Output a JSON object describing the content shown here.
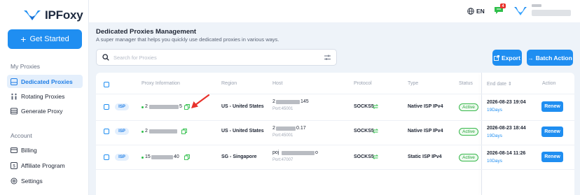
{
  "brand": {
    "name": "IPFoxy"
  },
  "sidebar": {
    "get_started": "Get Started",
    "section_proxies": "My Proxies",
    "nav_proxies": [
      {
        "label": "Dedicated Proxies",
        "icon": "list-icon",
        "active": true
      },
      {
        "label": "Rotating Proxies",
        "icon": "rotating-icon",
        "active": false
      },
      {
        "label": "Generate Proxy",
        "icon": "generate-icon",
        "active": false
      }
    ],
    "section_account": "Account",
    "nav_account": [
      {
        "label": "Billing",
        "icon": "billing-icon"
      },
      {
        "label": "Affiliate Program",
        "icon": "affiliate-icon"
      },
      {
        "label": "Settings",
        "icon": "settings-icon"
      }
    ]
  },
  "topbar": {
    "language": "EN",
    "message_count": "4"
  },
  "main": {
    "title": "Dedicated Proxies Management",
    "subtitle": "A super manager that helps you quickly use dedicated proxies in various ways.",
    "search_placeholder": "Search for Proxies",
    "export_label": "Export",
    "batch_label": "Batch Action"
  },
  "table": {
    "headers": {
      "proxy_info": "Proxy Information",
      "region": "Region",
      "host": "Host",
      "protocol": "Protocol",
      "type": "Type",
      "status": "Status",
      "end_date": "End date",
      "action": "Action"
    },
    "rows": [
      {
        "tag": "ISP",
        "proxy_pre": "2",
        "proxy_post": "5",
        "region": "US - United States",
        "host_pre": "2",
        "host_post": "145",
        "port": "Port:45001",
        "protocol": "SOCKS5",
        "type": "Native ISP IPv4",
        "status": "Active",
        "end_date": "2026-08-23 19:04",
        "days": "19Days",
        "action": "Renew"
      },
      {
        "tag": "ISP",
        "proxy_pre": "2",
        "proxy_post": "",
        "region": "US - United States",
        "host_pre": "2",
        "host_post": "0.17",
        "port": "Port:45001",
        "protocol": "SOCKS5",
        "type": "Native ISP IPv4",
        "status": "Active",
        "end_date": "2026-08-23 18:44",
        "days": "19Days",
        "action": "Renew"
      },
      {
        "tag": "ISP",
        "proxy_pre": "15",
        "proxy_post": "40",
        "region": "SG - Singapore",
        "host_pre": "poj",
        "host_post": "o",
        "port": "Port:47007",
        "protocol": "SOCKS5",
        "type": "Static ISP IPv4",
        "status": "Active",
        "end_date": "2026-08-14 11:26",
        "days": "10Days",
        "action": "Renew"
      }
    ]
  },
  "colors": {
    "accent": "#1f8ef1",
    "active": "#2aa53d",
    "badge": "#e8312b"
  }
}
